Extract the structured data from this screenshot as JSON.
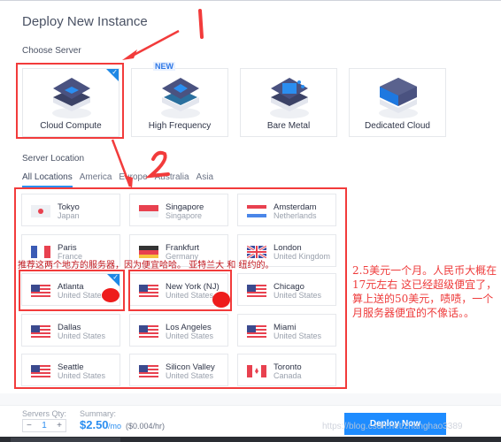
{
  "page": {
    "title": "Deploy New Instance"
  },
  "choose_server": {
    "label": "Choose Server",
    "new_badge": "NEW",
    "options": [
      {
        "label": "Cloud Compute",
        "selected": true,
        "icon": "cloud-compute-server-icon"
      },
      {
        "label": "High Frequency",
        "selected": false,
        "icon": "high-frequency-server-icon",
        "badge": "NEW"
      },
      {
        "label": "Bare Metal",
        "selected": false,
        "icon": "bare-metal-server-icon"
      },
      {
        "label": "Dedicated Cloud",
        "selected": false,
        "icon": "dedicated-cloud-server-icon"
      }
    ]
  },
  "server_location": {
    "label": "Server Location",
    "tabs": [
      {
        "label": "All Locations",
        "active": true
      },
      {
        "label": "America",
        "active": false
      },
      {
        "label": "Europe",
        "active": false
      },
      {
        "label": "Australia",
        "active": false
      },
      {
        "label": "Asia",
        "active": false
      }
    ],
    "locations": [
      {
        "city": "Tokyo",
        "country": "Japan",
        "flag": "jp",
        "selected": false
      },
      {
        "city": "Singapore",
        "country": "Singapore",
        "flag": "sg",
        "selected": false
      },
      {
        "city": "Amsterdam",
        "country": "Netherlands",
        "flag": "nl",
        "selected": false
      },
      {
        "city": "Paris",
        "country": "France",
        "flag": "fr",
        "selected": false
      },
      {
        "city": "Frankfurt",
        "country": "Germany",
        "flag": "de",
        "selected": false
      },
      {
        "city": "London",
        "country": "United Kingdom",
        "flag": "gb",
        "selected": false
      },
      {
        "city": "Atlanta",
        "country": "United States",
        "flag": "us",
        "selected": true
      },
      {
        "city": "New York (NJ)",
        "country": "United States",
        "flag": "us",
        "selected": false
      },
      {
        "city": "Chicago",
        "country": "United States",
        "flag": "us",
        "selected": false
      },
      {
        "city": "Dallas",
        "country": "United States",
        "flag": "us",
        "selected": false
      },
      {
        "city": "Los Angeles",
        "country": "United States",
        "flag": "us",
        "selected": false
      },
      {
        "city": "Miami",
        "country": "United States",
        "flag": "us",
        "selected": false
      },
      {
        "city": "Seattle",
        "country": "United States",
        "flag": "us",
        "selected": false
      },
      {
        "city": "Silicon Valley",
        "country": "United States",
        "flag": "us",
        "selected": false
      },
      {
        "city": "Toronto",
        "country": "Canada",
        "flag": "ca",
        "selected": false
      }
    ]
  },
  "footer": {
    "qty_label": "Servers Qty:",
    "qty_minus": "−",
    "qty_value": "1",
    "qty_plus": "+",
    "summary_label": "Summary:",
    "price": "$2.50",
    "price_unit": "/mo",
    "hourly": "($0.004/hr)",
    "deploy_label": "Deploy Now"
  },
  "annotations": {
    "step1": "1",
    "step2": "2",
    "recommend_note": "推荐这两个地方的服务器，因为便宜哈哈。 亚特兰大 和 纽约的。",
    "side_note": "2.5美元一个月。人民币大概在17元左右 这已经超级便宜了，算上送的50美元，啧啧，一个月服务器便宜的不像话。。",
    "colors": {
      "annotation_red": "#f23b3b",
      "note_red": "#ee3b3b",
      "brand_blue": "#1e8cff"
    }
  },
  "watermark": "https://blog.csdn.net/zhanghao3389"
}
